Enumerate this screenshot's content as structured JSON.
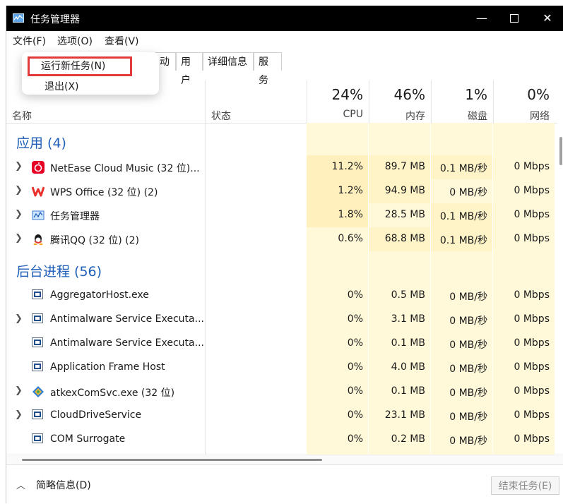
{
  "window": {
    "title": "任务管理器",
    "minimize": "—",
    "close": "✕"
  },
  "menubar": {
    "file": "文件(F)",
    "options": "选项(O)",
    "view": "查看(V)"
  },
  "file_menu": {
    "run_new_task": "运行新任务(N)",
    "exit": "退出(X)"
  },
  "tabs": {
    "startup": "启动",
    "users": "用户",
    "details": "详细信息",
    "services": "服务"
  },
  "header": {
    "name": "名称",
    "status": "状态",
    "cpu_pct": "24%",
    "cpu": "CPU",
    "mem_pct": "46%",
    "mem": "内存",
    "disk_pct": "1%",
    "disk": "磁盘",
    "net_pct": "0%",
    "net": "网络"
  },
  "groups": {
    "apps": "应用 (4)",
    "background": "后台进程 (56)"
  },
  "processes": [
    {
      "name": "NetEase Cloud Music (32 位)...",
      "cpu": "11.2%",
      "mem": "89.7 MB",
      "disk": "0.1 MB/秒",
      "net": "0 Mbps",
      "icon": "netease-music-icon"
    },
    {
      "name": "WPS Office (32 位) (2)",
      "cpu": "1.2%",
      "mem": "94.9 MB",
      "disk": "0 MB/秒",
      "net": "0 Mbps",
      "icon": "wps-icon"
    },
    {
      "name": "任务管理器",
      "cpu": "1.8%",
      "mem": "28.5 MB",
      "disk": "0.1 MB/秒",
      "net": "0 Mbps",
      "icon": "task-manager-icon"
    },
    {
      "name": "腾讯QQ (32 位) (2)",
      "cpu": "0.6%",
      "mem": "68.8 MB",
      "disk": "0.1 MB/秒",
      "net": "0 Mbps",
      "icon": "qq-icon"
    },
    {
      "name": "AggregatorHost.exe",
      "cpu": "0%",
      "mem": "0.5 MB",
      "disk": "0 MB/秒",
      "net": "0 Mbps",
      "icon": "app-window-icon"
    },
    {
      "name": "Antimalware Service Executa...",
      "cpu": "0%",
      "mem": "3.1 MB",
      "disk": "0 MB/秒",
      "net": "0 Mbps",
      "icon": "app-window-icon"
    },
    {
      "name": "Antimalware Service Executa...",
      "cpu": "0%",
      "mem": "0.1 MB",
      "disk": "0 MB/秒",
      "net": "0 Mbps",
      "icon": "app-window-icon"
    },
    {
      "name": "Application Frame Host",
      "cpu": "0%",
      "mem": "4.0 MB",
      "disk": "0 MB/秒",
      "net": "0 Mbps",
      "icon": "app-window-icon"
    },
    {
      "name": "atkexComSvc.exe (32 位)",
      "cpu": "0%",
      "mem": "0.1 MB",
      "disk": "0 MB/秒",
      "net": "0 Mbps",
      "icon": "diamond-icon"
    },
    {
      "name": "CloudDriveService",
      "cpu": "0%",
      "mem": "23.1 MB",
      "disk": "0 MB/秒",
      "net": "0 Mbps",
      "icon": "app-window-icon"
    },
    {
      "name": "COM Surrogate",
      "cpu": "0%",
      "mem": "0.2 MB",
      "disk": "0 MB/秒",
      "net": "0 Mbps",
      "icon": "app-window-icon"
    }
  ],
  "footer": {
    "fewer_details": "简略信息(D)",
    "end_task": "结束任务(E)"
  },
  "colors": {
    "accent_blue": "#1f5fb8",
    "highlight_red": "#e03a3a",
    "heat_light": "#fff9d9",
    "heat_medium": "#fff0bd"
  }
}
